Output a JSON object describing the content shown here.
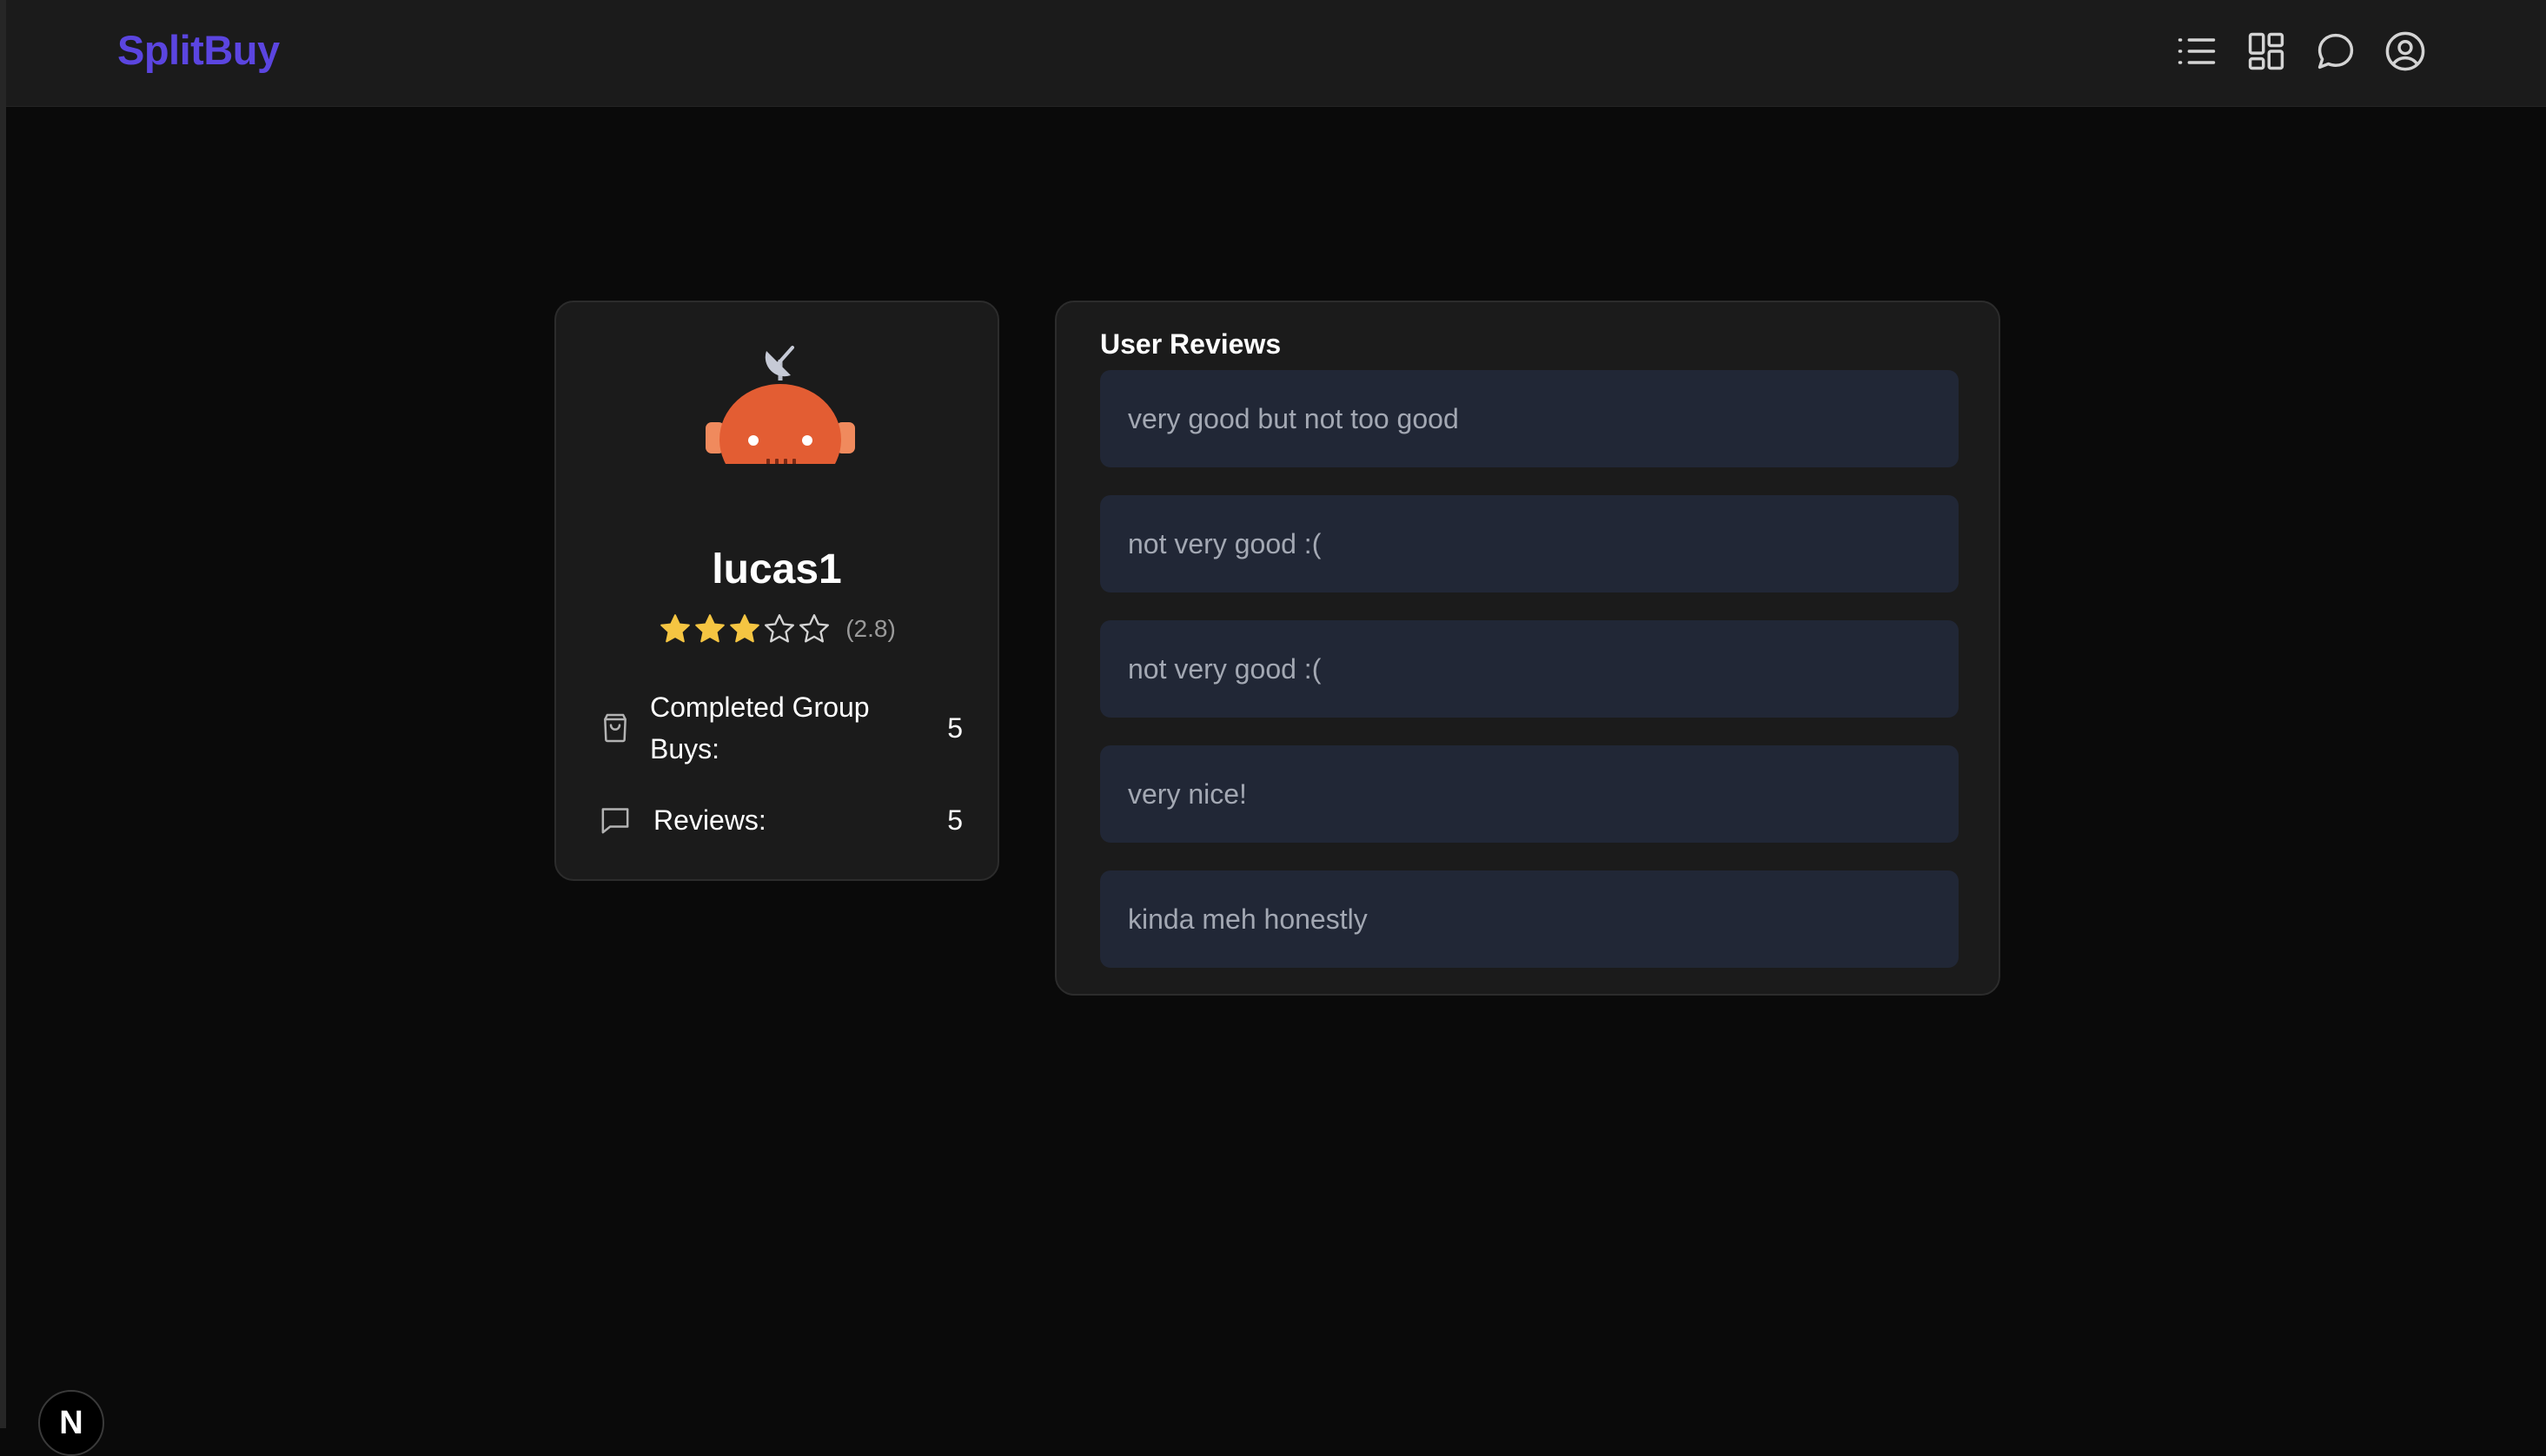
{
  "brand": {
    "name": "SplitBuy",
    "color": "#5b45e0"
  },
  "nav": {
    "icons": [
      "list-icon",
      "grid-icon",
      "chat-icon",
      "account-icon"
    ]
  },
  "profile": {
    "username": "lucas1",
    "rating": {
      "value": 2.8,
      "display": "(2.8)",
      "filled_stars": 3,
      "total_stars": 5,
      "star_color": "#f5c542"
    },
    "stats": {
      "completed_label": "Completed Group Buys:",
      "completed_value": "5",
      "reviews_label": "Reviews:",
      "reviews_value": "5"
    }
  },
  "reviews": {
    "title": "User Reviews",
    "items": [
      "very good but not too good",
      "not very good :(",
      "not very good :(",
      "very nice!",
      "kinda meh honestly"
    ]
  },
  "dev_badge": {
    "label": "N"
  }
}
